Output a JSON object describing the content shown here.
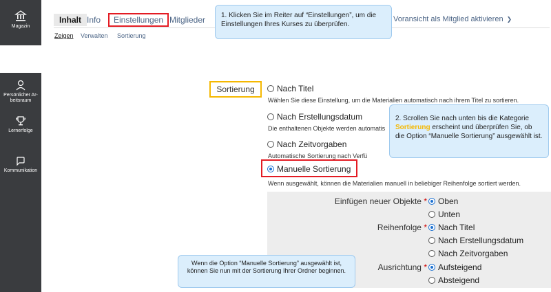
{
  "sidebar": {
    "items": [
      {
        "label": "Magazin",
        "icon": "building-icon"
      },
      {
        "label": "Persönlicher Ar-beitsraum",
        "icon": "person-icon"
      },
      {
        "label": "Lernerfolge",
        "icon": "trophy-icon"
      },
      {
        "label": "Kommunikation",
        "icon": "chat-icon"
      }
    ]
  },
  "tabs": {
    "items": [
      "Inhalt",
      "Info",
      "Einstellungen",
      "Mitglieder"
    ],
    "preview": "Voransicht als Mitglied aktivieren",
    "preview_arrow": "❯"
  },
  "subtabs": [
    "Zeigen",
    "Verwalten",
    "Sortierung"
  ],
  "callouts": {
    "step1": "1. Klicken Sie im Reiter auf “Einstellungen”, um die Einstellungen Ihres Kurses zu überprüfen.",
    "step2_pre": "2. Scrollen Sie nach unten bis die Kategorie ",
    "step2_highlight": "Sortierung",
    "step2_post": " erscheint und überprüfen Sie, ob die Option “Manuelle Sortierung” ausgewählt ist.",
    "note": "Wenn die Option “Manuelle Sortierung” ausgewählt ist, können Sie nun mit der Sortierung Ihrer Ordner beginnen."
  },
  "form": {
    "section_label": "Sortierung",
    "options": [
      {
        "label": "Nach Titel",
        "desc": "Wählen Sie diese Einstellung, um die Materialien automatisch nach ihrem Titel zu sortieren."
      },
      {
        "label": "Nach Erstellungsdatum",
        "desc": "Die enthaltenen Objekte werden automatis"
      },
      {
        "label": "Nach Zeitvorgaben",
        "desc": "Automatische Sortierung nach Verfü"
      },
      {
        "label": "Manuelle Sortierung",
        "desc": "Wenn ausgewählt, können die Materialien manuell in beliebiger Reihenfolge sortiert werden."
      }
    ],
    "selected": "Manuelle Sortierung",
    "sub": {
      "insert_label": "Einfügen neuer Objekte",
      "insert_options": [
        "Oben",
        "Unten"
      ],
      "order_label": "Reihenfolge",
      "order_options": [
        "Nach Titel",
        "Nach Erstellungsdatum",
        "Nach Zeitvorgaben"
      ],
      "direction_label": "Ausrichtung",
      "direction_options": [
        "Aufsteigend",
        "Absteigend"
      ],
      "required_mark": "*"
    }
  },
  "colors": {
    "highlight": "#f5b800",
    "red_box": "#e31b23",
    "callout_bg": "#dbeefc",
    "sidebar_bg": "#3a3c3f",
    "link": "#4c6586"
  }
}
